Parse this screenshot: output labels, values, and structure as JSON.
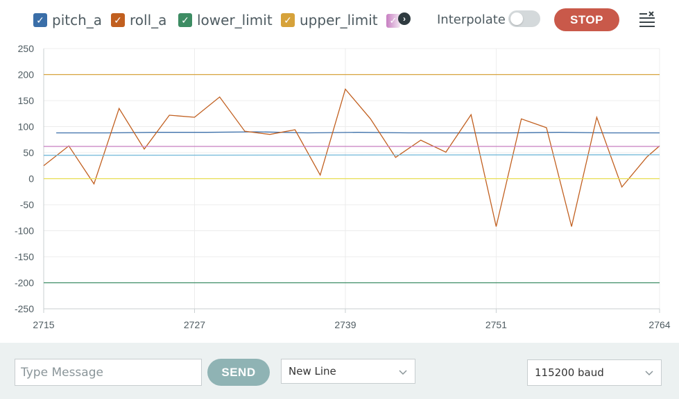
{
  "legend": [
    {
      "label": "pitch_a",
      "color": "#3a6ea8",
      "checked": true
    },
    {
      "label": "roll_a",
      "color": "#c15f1f",
      "checked": true
    },
    {
      "label": "lower_limit",
      "color": "#3d8c63",
      "checked": true
    },
    {
      "label": "upper_limit",
      "color": "#d6a23a",
      "checked": true
    }
  ],
  "legend_more_icon": "chevron-right-icon",
  "interpolate": {
    "label": "Interpolate",
    "on": false
  },
  "stop_label": "STOP",
  "clear_icon": "clear-list-icon",
  "message_input": {
    "placeholder": "Type Message",
    "value": ""
  },
  "send_label": "SEND",
  "line_ending": {
    "selected": "New Line"
  },
  "baud": {
    "selected": "115200 baud"
  },
  "chart_data": {
    "type": "line",
    "title": "",
    "xlabel": "",
    "ylabel": "",
    "xlim": [
      2715,
      2764
    ],
    "ylim": [
      -250,
      250
    ],
    "x_ticks": [
      2715,
      2727,
      2739,
      2751,
      2764
    ],
    "y_ticks": [
      250,
      200,
      150,
      100,
      50,
      0,
      -50,
      -100,
      -150,
      -200,
      -250
    ],
    "grid": true,
    "series": [
      {
        "name": "pitch_a",
        "color": "#3a6ea8",
        "x": [
          2716,
          2720,
          2724,
          2728,
          2732,
          2736,
          2740,
          2744,
          2748,
          2752,
          2756,
          2760,
          2764
        ],
        "y": [
          88,
          88,
          89,
          89,
          90,
          88,
          89,
          88,
          88,
          88,
          89,
          88,
          88
        ]
      },
      {
        "name": "roll_a",
        "color": "#c15f1f",
        "x": [
          2715,
          2717,
          2719,
          2721,
          2723,
          2725,
          2727,
          2729,
          2731,
          2733,
          2735,
          2737,
          2739,
          2741,
          2743,
          2745,
          2747,
          2749,
          2751,
          2753,
          2755,
          2757,
          2759,
          2761,
          2763,
          2764
        ],
        "y": [
          25,
          63,
          -10,
          135,
          57,
          122,
          118,
          157,
          91,
          85,
          94,
          7,
          172,
          115,
          41,
          74,
          51,
          123,
          -92,
          115,
          98,
          -92,
          118,
          -16,
          42,
          63
        ]
      },
      {
        "name": "lower_limit",
        "color": "#3d8c63",
        "x": [
          2715,
          2764
        ],
        "y": [
          -200,
          -200
        ]
      },
      {
        "name": "upper_limit",
        "color": "#d6a23a",
        "x": [
          2715,
          2764
        ],
        "y": [
          200,
          200
        ]
      },
      {
        "color": "#c77dc1",
        "x": [
          2715,
          2764
        ],
        "y": [
          62,
          62
        ]
      },
      {
        "color": "#6fb7d8",
        "x": [
          2715,
          2764
        ],
        "y": [
          45,
          46
        ]
      },
      {
        "color": "#e7dd4f",
        "x": [
          2715,
          2764
        ],
        "y": [
          0,
          0
        ]
      }
    ]
  }
}
